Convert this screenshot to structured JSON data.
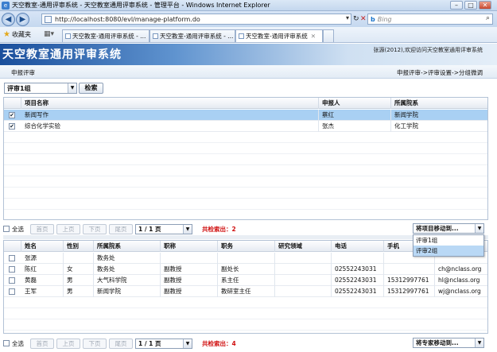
{
  "window": {
    "title": "天空教室-通用评审系统 - 天空教室通用评审系统 - 管理平台 - Windows Internet Explorer",
    "controls": [
      "–",
      "□",
      "✕"
    ]
  },
  "browser": {
    "url": "http://localhost:8080/evl/manage-platform.do",
    "search_engine": "b",
    "search_placeholder": "Bing",
    "favorites_label": "收藏夹",
    "tabs": [
      {
        "label": "天空教室-通用评审系统 - ...",
        "active": false
      },
      {
        "label": "天空教室-通用评审系统 - ...",
        "active": false
      },
      {
        "label": "天空教室-通用评审系统",
        "active": true
      }
    ]
  },
  "app": {
    "title": "天空教室通用评审系统",
    "welcome": "张源(2012),欢迎访问天空教室通用评审系统",
    "page_label": "申报评审",
    "breadcrumb": "申报评审->评审设置->分组微调"
  },
  "filter": {
    "group_value": "评审1组",
    "search_label": "检索"
  },
  "projects": {
    "columns": [
      "项目名称",
      "申报人",
      "所属院系"
    ],
    "rows": [
      {
        "name": "新闻写作",
        "applicant": "蔡红",
        "dept": "新闻学院",
        "checked": true,
        "selected": true
      },
      {
        "name": "综合化学实验",
        "applicant": "张杰",
        "dept": "化工学院",
        "checked": true,
        "selected": false
      }
    ],
    "pager": {
      "select_all": "全选",
      "first": "首页",
      "prev": "上页",
      "next": "下页",
      "last": "尾页",
      "page": "1 / 1 页",
      "count_text": "共检索出：2"
    },
    "move_button": "将项目移动到...",
    "move_options": [
      "评审1组",
      "评审2组"
    ],
    "move_highlighted": "评审2组"
  },
  "experts": {
    "columns": [
      "姓名",
      "性别",
      "所属院系",
      "职称",
      "职务",
      "研究领域",
      "电话",
      "手机",
      ""
    ],
    "rows": [
      {
        "name": "张源",
        "gender": "",
        "dept": "教务处",
        "title": "",
        "position": "",
        "field": "",
        "phone": "",
        "mobile": "",
        "email": ""
      },
      {
        "name": "陈红",
        "gender": "女",
        "dept": "教务处",
        "title": "副教授",
        "position": "副处长",
        "field": "",
        "phone": "02552243031",
        "mobile": "",
        "email": "ch@nclass.org"
      },
      {
        "name": "黄磊",
        "gender": "男",
        "dept": "大气科学院",
        "title": "副教授",
        "position": "系主任",
        "field": "",
        "phone": "02552243031",
        "mobile": "15312997761",
        "email": "hl@nclass.org"
      },
      {
        "name": "王军",
        "gender": "男",
        "dept": "新闻学院",
        "title": "副教授",
        "position": "教研室主任",
        "field": "",
        "phone": "02552243031",
        "mobile": "15312997761",
        "email": "wj@nclass.org"
      }
    ],
    "pager": {
      "select_all": "全选",
      "first": "首页",
      "prev": "上页",
      "next": "下页",
      "last": "尾页",
      "page": "1 / 1 页",
      "count_text": "共检索出：4"
    },
    "move_button": "将专家移动到..."
  }
}
